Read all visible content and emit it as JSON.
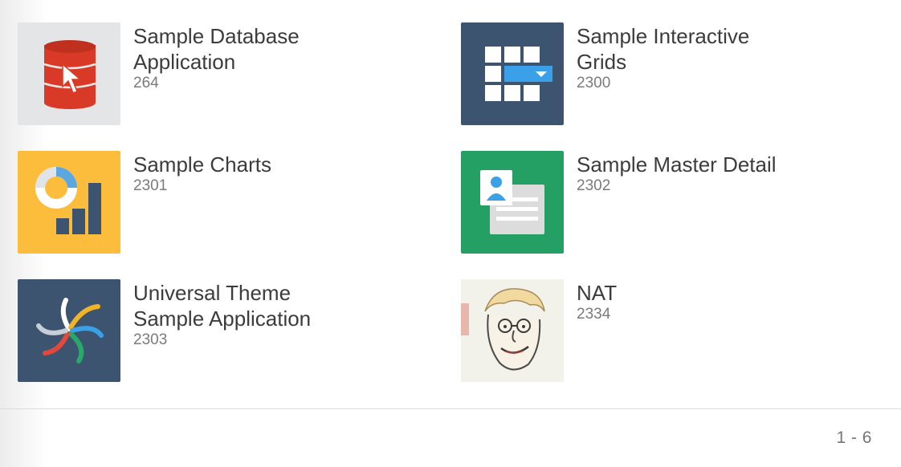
{
  "apps": [
    {
      "title": "Sample Database Application",
      "title_line1": "Sample Database",
      "title_line2": "Application",
      "id": "264",
      "icon": "database-pointer-icon",
      "tile_color": "#e4e5e6"
    },
    {
      "title": "Sample Interactive Grids",
      "title_line1": "Sample Interactive",
      "title_line2": "Grids",
      "id": "2300",
      "icon": "interactive-grid-icon",
      "tile_color": "#3d5470"
    },
    {
      "title": "Sample Charts",
      "title_line1": "Sample Charts",
      "title_line2": "",
      "id": "2301",
      "icon": "charts-icon",
      "tile_color": "#fdbd3c"
    },
    {
      "title": "Sample Master Detail",
      "title_line1": "Sample Master Detail",
      "title_line2": "",
      "id": "2302",
      "icon": "master-detail-icon",
      "tile_color": "#25a064"
    },
    {
      "title": "Universal Theme Sample Application",
      "title_line1": "Universal Theme",
      "title_line2": "Sample Application",
      "id": "2303",
      "icon": "universal-theme-icon",
      "tile_color": "#3d5470"
    },
    {
      "title": "NAT",
      "title_line1": "NAT",
      "title_line2": "",
      "id": "2334",
      "icon": "caricature-portrait-icon",
      "tile_color": "#f2f2ec"
    }
  ],
  "pagination": {
    "range": "1 - 6"
  },
  "colors": {
    "title": "#3c3c3c",
    "subtitle": "#7a7a7a",
    "divider": "#dcdcdc"
  }
}
